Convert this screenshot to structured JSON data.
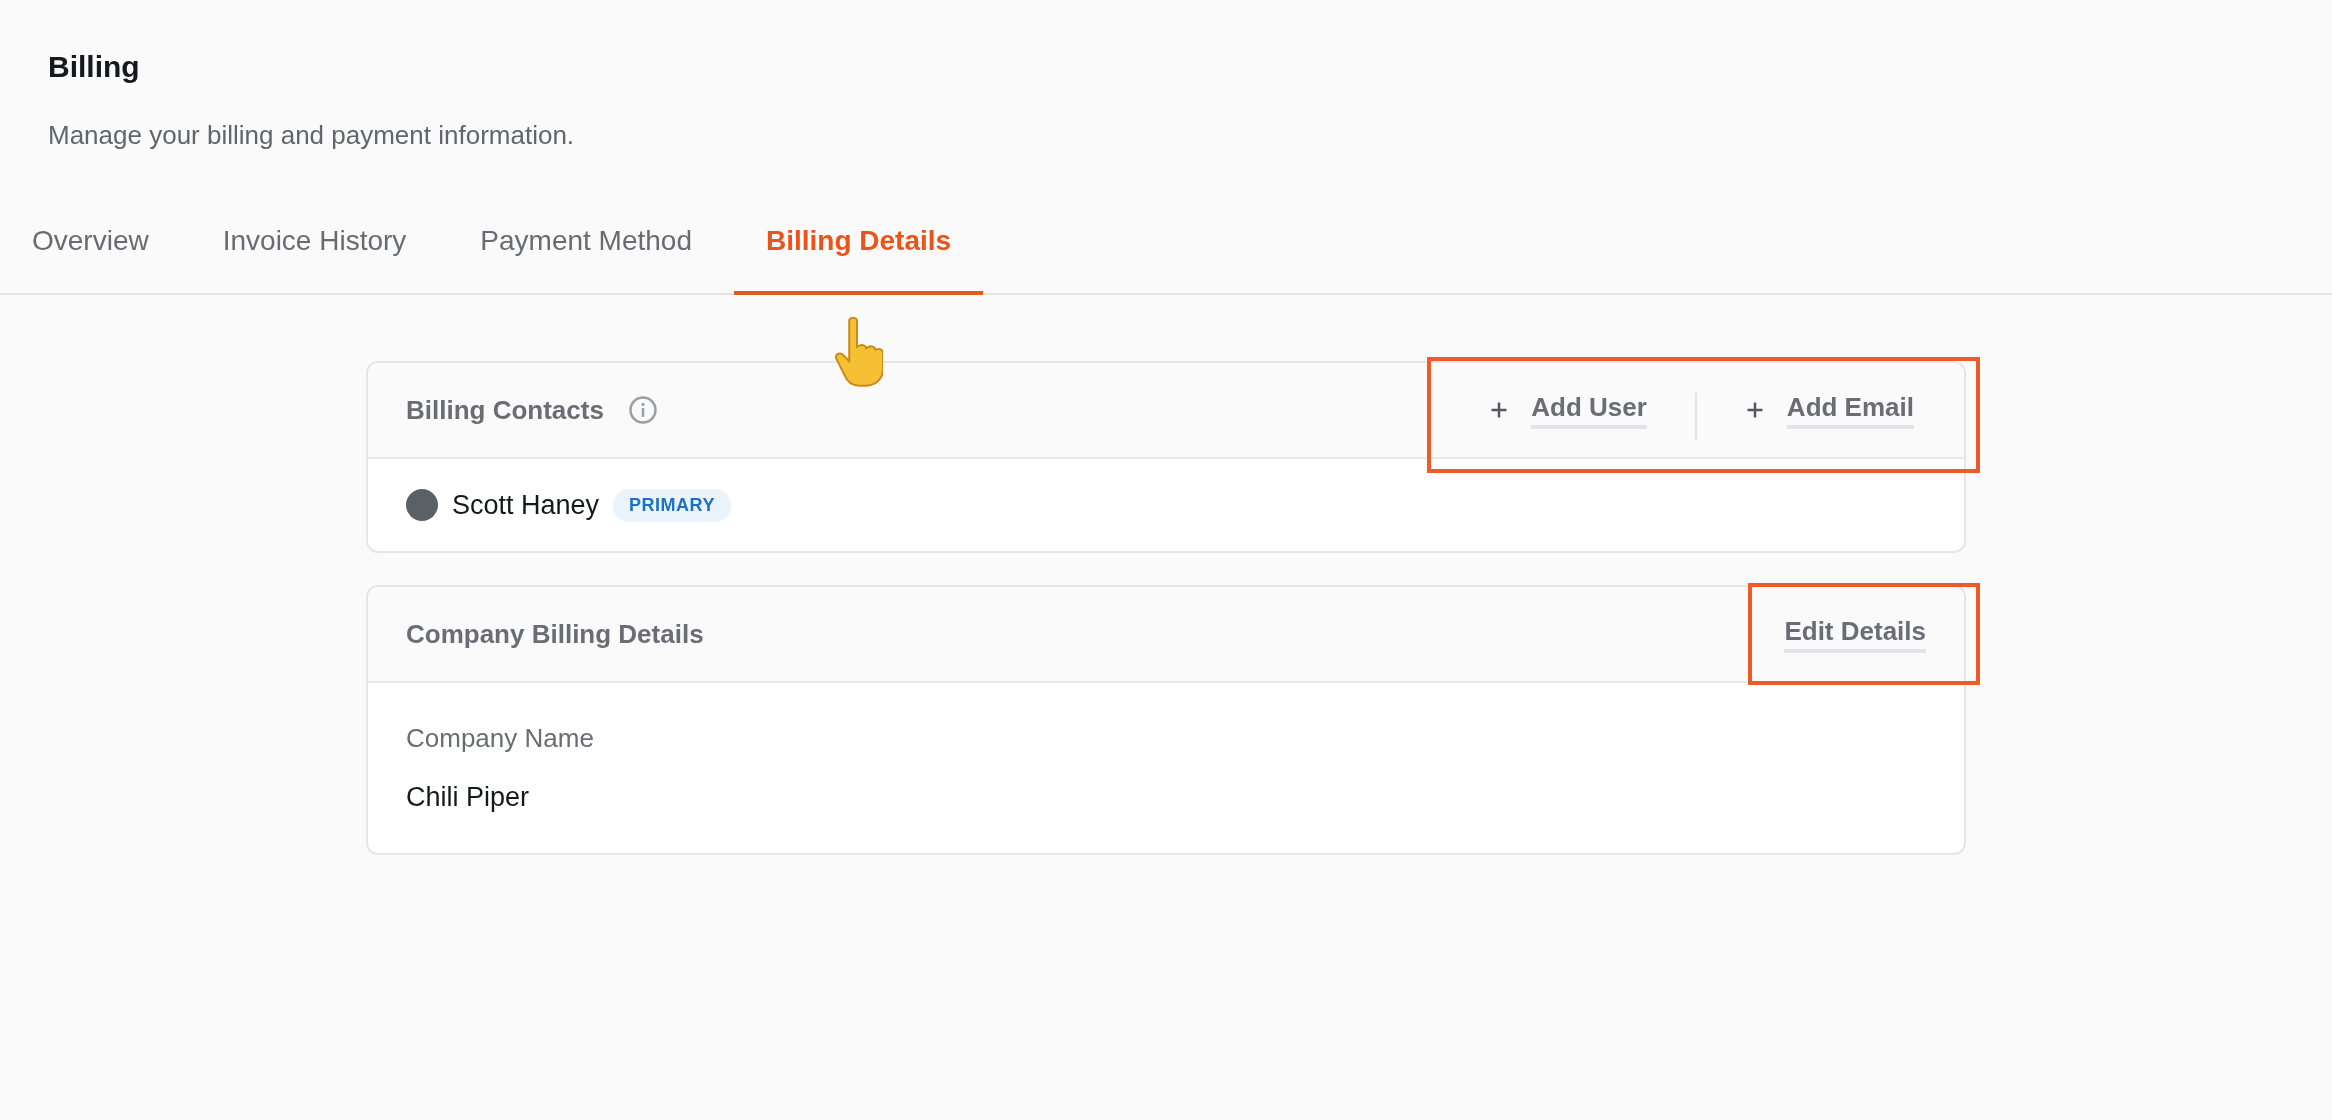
{
  "page": {
    "title": "Billing",
    "subtitle": "Manage your billing and payment information."
  },
  "tabs": [
    {
      "label": "Overview",
      "selected": false
    },
    {
      "label": "Invoice History",
      "selected": false
    },
    {
      "label": "Payment Method",
      "selected": false
    },
    {
      "label": "Billing Details",
      "selected": true
    }
  ],
  "contacts_card": {
    "title": "Billing Contacts",
    "actions": [
      {
        "label": "Add User"
      },
      {
        "label": "Add Email"
      }
    ],
    "contacts": [
      {
        "name": "Scott Haney",
        "badge": "PRIMARY"
      }
    ]
  },
  "company_card": {
    "title": "Company Billing Details",
    "action": "Edit Details",
    "fields": [
      {
        "label": "Company Name",
        "value": "Chili Piper"
      }
    ]
  }
}
